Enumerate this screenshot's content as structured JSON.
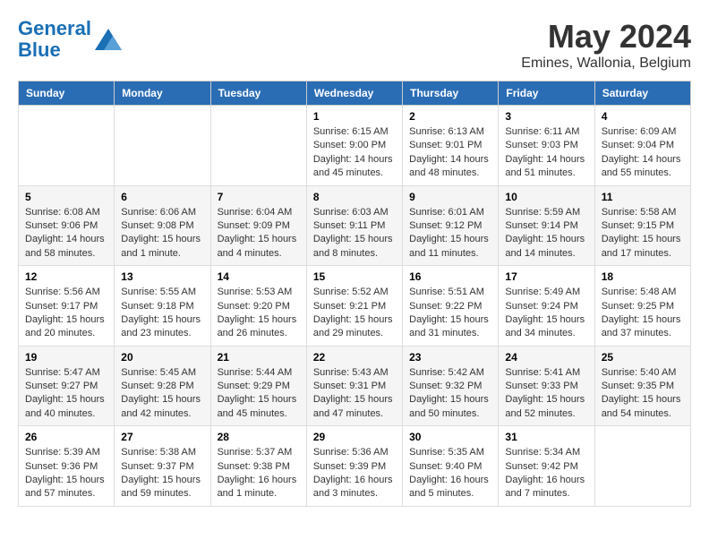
{
  "logo": {
    "text_general": "General",
    "text_blue": "Blue"
  },
  "title": "May 2024",
  "subtitle": "Emines, Wallonia, Belgium",
  "weekdays": [
    "Sunday",
    "Monday",
    "Tuesday",
    "Wednesday",
    "Thursday",
    "Friday",
    "Saturday"
  ],
  "weeks": [
    [
      {
        "day": "",
        "info": ""
      },
      {
        "day": "",
        "info": ""
      },
      {
        "day": "",
        "info": ""
      },
      {
        "day": "1",
        "info": "Sunrise: 6:15 AM\nSunset: 9:00 PM\nDaylight: 14 hours and 45 minutes."
      },
      {
        "day": "2",
        "info": "Sunrise: 6:13 AM\nSunset: 9:01 PM\nDaylight: 14 hours and 48 minutes."
      },
      {
        "day": "3",
        "info": "Sunrise: 6:11 AM\nSunset: 9:03 PM\nDaylight: 14 hours and 51 minutes."
      },
      {
        "day": "4",
        "info": "Sunrise: 6:09 AM\nSunset: 9:04 PM\nDaylight: 14 hours and 55 minutes."
      }
    ],
    [
      {
        "day": "5",
        "info": "Sunrise: 6:08 AM\nSunset: 9:06 PM\nDaylight: 14 hours and 58 minutes."
      },
      {
        "day": "6",
        "info": "Sunrise: 6:06 AM\nSunset: 9:08 PM\nDaylight: 15 hours and 1 minute."
      },
      {
        "day": "7",
        "info": "Sunrise: 6:04 AM\nSunset: 9:09 PM\nDaylight: 15 hours and 4 minutes."
      },
      {
        "day": "8",
        "info": "Sunrise: 6:03 AM\nSunset: 9:11 PM\nDaylight: 15 hours and 8 minutes."
      },
      {
        "day": "9",
        "info": "Sunrise: 6:01 AM\nSunset: 9:12 PM\nDaylight: 15 hours and 11 minutes."
      },
      {
        "day": "10",
        "info": "Sunrise: 5:59 AM\nSunset: 9:14 PM\nDaylight: 15 hours and 14 minutes."
      },
      {
        "day": "11",
        "info": "Sunrise: 5:58 AM\nSunset: 9:15 PM\nDaylight: 15 hours and 17 minutes."
      }
    ],
    [
      {
        "day": "12",
        "info": "Sunrise: 5:56 AM\nSunset: 9:17 PM\nDaylight: 15 hours and 20 minutes."
      },
      {
        "day": "13",
        "info": "Sunrise: 5:55 AM\nSunset: 9:18 PM\nDaylight: 15 hours and 23 minutes."
      },
      {
        "day": "14",
        "info": "Sunrise: 5:53 AM\nSunset: 9:20 PM\nDaylight: 15 hours and 26 minutes."
      },
      {
        "day": "15",
        "info": "Sunrise: 5:52 AM\nSunset: 9:21 PM\nDaylight: 15 hours and 29 minutes."
      },
      {
        "day": "16",
        "info": "Sunrise: 5:51 AM\nSunset: 9:22 PM\nDaylight: 15 hours and 31 minutes."
      },
      {
        "day": "17",
        "info": "Sunrise: 5:49 AM\nSunset: 9:24 PM\nDaylight: 15 hours and 34 minutes."
      },
      {
        "day": "18",
        "info": "Sunrise: 5:48 AM\nSunset: 9:25 PM\nDaylight: 15 hours and 37 minutes."
      }
    ],
    [
      {
        "day": "19",
        "info": "Sunrise: 5:47 AM\nSunset: 9:27 PM\nDaylight: 15 hours and 40 minutes."
      },
      {
        "day": "20",
        "info": "Sunrise: 5:45 AM\nSunset: 9:28 PM\nDaylight: 15 hours and 42 minutes."
      },
      {
        "day": "21",
        "info": "Sunrise: 5:44 AM\nSunset: 9:29 PM\nDaylight: 15 hours and 45 minutes."
      },
      {
        "day": "22",
        "info": "Sunrise: 5:43 AM\nSunset: 9:31 PM\nDaylight: 15 hours and 47 minutes."
      },
      {
        "day": "23",
        "info": "Sunrise: 5:42 AM\nSunset: 9:32 PM\nDaylight: 15 hours and 50 minutes."
      },
      {
        "day": "24",
        "info": "Sunrise: 5:41 AM\nSunset: 9:33 PM\nDaylight: 15 hours and 52 minutes."
      },
      {
        "day": "25",
        "info": "Sunrise: 5:40 AM\nSunset: 9:35 PM\nDaylight: 15 hours and 54 minutes."
      }
    ],
    [
      {
        "day": "26",
        "info": "Sunrise: 5:39 AM\nSunset: 9:36 PM\nDaylight: 15 hours and 57 minutes."
      },
      {
        "day": "27",
        "info": "Sunrise: 5:38 AM\nSunset: 9:37 PM\nDaylight: 15 hours and 59 minutes."
      },
      {
        "day": "28",
        "info": "Sunrise: 5:37 AM\nSunset: 9:38 PM\nDaylight: 16 hours and 1 minute."
      },
      {
        "day": "29",
        "info": "Sunrise: 5:36 AM\nSunset: 9:39 PM\nDaylight: 16 hours and 3 minutes."
      },
      {
        "day": "30",
        "info": "Sunrise: 5:35 AM\nSunset: 9:40 PM\nDaylight: 16 hours and 5 minutes."
      },
      {
        "day": "31",
        "info": "Sunrise: 5:34 AM\nSunset: 9:42 PM\nDaylight: 16 hours and 7 minutes."
      },
      {
        "day": "",
        "info": ""
      }
    ]
  ]
}
